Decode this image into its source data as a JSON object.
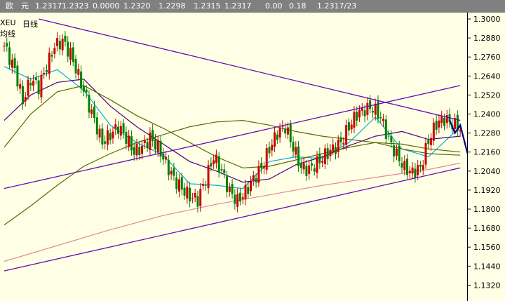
{
  "header": {
    "currency": "欧　元",
    "values": [
      "1.2317",
      "1.2323",
      "0.0000",
      "1.2320",
      "1.2298",
      "1.2315",
      "1.2317",
      "0.00",
      "0.18",
      "1.2317/23"
    ]
  },
  "chart_labels": {
    "symbol": "XEU",
    "period": "日线",
    "overlay": "均线"
  },
  "colors": {
    "background": "#ffffe6",
    "header_bg": "#808080",
    "candle_up": "#cc0000",
    "candle_down": "#008000",
    "trendline": "#6a0dad",
    "ma_short": "#00b0e0",
    "ma_medium": "#4b0082",
    "ma_long": "#556b00",
    "ma_extra": "#e08a9a",
    "forecast": "#00008b"
  },
  "chart_data": {
    "type": "candlestick",
    "title": "",
    "ylim": [
      1.122,
      1.304
    ],
    "yticks": [
      "1.3000",
      "1.2880",
      "1.2760",
      "1.2640",
      "1.2520",
      "1.2400",
      "1.2280",
      "1.2160",
      "1.2040",
      "1.1920",
      "1.1800",
      "1.1680",
      "1.1560",
      "1.1440",
      "1.1320"
    ],
    "grid": false,
    "price_path": [
      [
        0,
        1.283
      ],
      [
        4,
        1.268
      ],
      [
        7,
        1.248
      ],
      [
        10,
        1.262
      ],
      [
        13,
        1.257
      ],
      [
        16,
        1.27
      ],
      [
        19,
        1.283
      ],
      [
        22,
        1.286
      ],
      [
        25,
        1.278
      ],
      [
        28,
        1.264
      ],
      [
        31,
        1.25
      ],
      [
        34,
        1.236
      ],
      [
        37,
        1.222
      ],
      [
        40,
        1.227
      ],
      [
        43,
        1.232
      ],
      [
        46,
        1.225
      ],
      [
        49,
        1.216
      ],
      [
        52,
        1.219
      ],
      [
        55,
        1.225
      ],
      [
        58,
        1.219
      ],
      [
        61,
        1.209
      ],
      [
        64,
        1.199
      ],
      [
        67,
        1.193
      ],
      [
        70,
        1.188
      ],
      [
        73,
        1.186
      ],
      [
        76,
        1.199
      ],
      [
        79,
        1.213
      ],
      [
        82,
        1.204
      ],
      [
        85,
        1.191
      ],
      [
        88,
        1.185
      ],
      [
        91,
        1.191
      ],
      [
        94,
        1.199
      ],
      [
        97,
        1.206
      ],
      [
        100,
        1.218
      ],
      [
        103,
        1.228
      ],
      [
        106,
        1.232
      ],
      [
        109,
        1.219
      ],
      [
        112,
        1.206
      ],
      [
        115,
        1.205
      ],
      [
        118,
        1.209
      ],
      [
        121,
        1.214
      ],
      [
        124,
        1.218
      ],
      [
        127,
        1.222
      ],
      [
        130,
        1.232
      ],
      [
        133,
        1.24
      ],
      [
        136,
        1.243
      ],
      [
        139,
        1.244
      ],
      [
        142,
        1.238
      ],
      [
        145,
        1.224
      ],
      [
        148,
        1.214
      ],
      [
        151,
        1.206
      ],
      [
        154,
        1.203
      ],
      [
        157,
        1.206
      ],
      [
        160,
        1.223
      ],
      [
        163,
        1.234
      ],
      [
        166,
        1.237
      ],
      [
        169,
        1.234
      ],
      [
        172,
        1.231
      ]
    ],
    "moving_averages": [
      {
        "name": "",
        "path": [
          [
            0,
            1.27
          ],
          [
            10,
            1.262
          ],
          [
            20,
            1.268
          ],
          [
            30,
            1.255
          ],
          [
            40,
            1.233
          ],
          [
            50,
            1.222
          ],
          [
            60,
            1.214
          ],
          [
            70,
            1.196
          ],
          [
            80,
            1.195
          ],
          [
            90,
            1.193
          ],
          [
            100,
            1.21
          ],
          [
            110,
            1.213
          ],
          [
            120,
            1.212
          ],
          [
            130,
            1.222
          ],
          [
            140,
            1.238
          ],
          [
            150,
            1.218
          ],
          [
            160,
            1.213
          ],
          [
            172,
            1.232
          ]
        ]
      },
      {
        "name": "",
        "path": [
          [
            0,
            1.236
          ],
          [
            10,
            1.252
          ],
          [
            20,
            1.26
          ],
          [
            30,
            1.262
          ],
          [
            40,
            1.245
          ],
          [
            50,
            1.232
          ],
          [
            60,
            1.221
          ],
          [
            70,
            1.21
          ],
          [
            80,
            1.204
          ],
          [
            90,
            1.197
          ],
          [
            100,
            1.199
          ],
          [
            110,
            1.208
          ],
          [
            120,
            1.213
          ],
          [
            130,
            1.22
          ],
          [
            140,
            1.226
          ],
          [
            150,
            1.229
          ],
          [
            160,
            1.224
          ],
          [
            172,
            1.226
          ]
        ]
      },
      {
        "name": "",
        "path": [
          [
            0,
            1.219
          ],
          [
            10,
            1.24
          ],
          [
            20,
            1.254
          ],
          [
            30,
            1.258
          ],
          [
            40,
            1.249
          ],
          [
            50,
            1.239
          ],
          [
            60,
            1.231
          ],
          [
            70,
            1.222
          ],
          [
            80,
            1.213
          ],
          [
            90,
            1.206
          ],
          [
            100,
            1.207
          ],
          [
            110,
            1.211
          ],
          [
            120,
            1.215
          ],
          [
            130,
            1.219
          ],
          [
            140,
            1.222
          ],
          [
            150,
            1.221
          ],
          [
            160,
            1.218
          ],
          [
            172,
            1.216
          ]
        ]
      },
      {
        "name": "",
        "path": [
          [
            0,
            1.17
          ],
          [
            10,
            1.182
          ],
          [
            20,
            1.195
          ],
          [
            30,
            1.207
          ],
          [
            40,
            1.215
          ],
          [
            50,
            1.222
          ],
          [
            60,
            1.227
          ],
          [
            70,
            1.232
          ],
          [
            80,
            1.235
          ],
          [
            90,
            1.236
          ],
          [
            100,
            1.233
          ],
          [
            110,
            1.229
          ],
          [
            120,
            1.226
          ],
          [
            130,
            1.224
          ],
          [
            140,
            1.222
          ],
          [
            150,
            1.218
          ],
          [
            160,
            1.215
          ],
          [
            172,
            1.214
          ]
        ]
      },
      {
        "name": "",
        "path": [
          [
            0,
            1.147
          ],
          [
            20,
            1.157
          ],
          [
            40,
            1.167
          ],
          [
            60,
            1.176
          ],
          [
            80,
            1.183
          ],
          [
            100,
            1.189
          ],
          [
            120,
            1.195
          ],
          [
            140,
            1.2
          ],
          [
            160,
            1.205
          ],
          [
            172,
            1.209
          ]
        ]
      }
    ],
    "trendlines": [
      {
        "from": [
          13,
          1.3
        ],
        "to": [
          172,
          1.236
        ]
      },
      {
        "from": [
          0,
          1.193
        ],
        "to": [
          172,
          1.258
        ]
      },
      {
        "from": [
          0,
          1.141
        ],
        "to": [
          172,
          1.206
        ]
      }
    ],
    "forecast_path": [
      [
        168,
        1.236
      ],
      [
        170,
        1.228
      ],
      [
        172,
        1.233
      ],
      [
        176,
        1.207
      ]
    ]
  }
}
